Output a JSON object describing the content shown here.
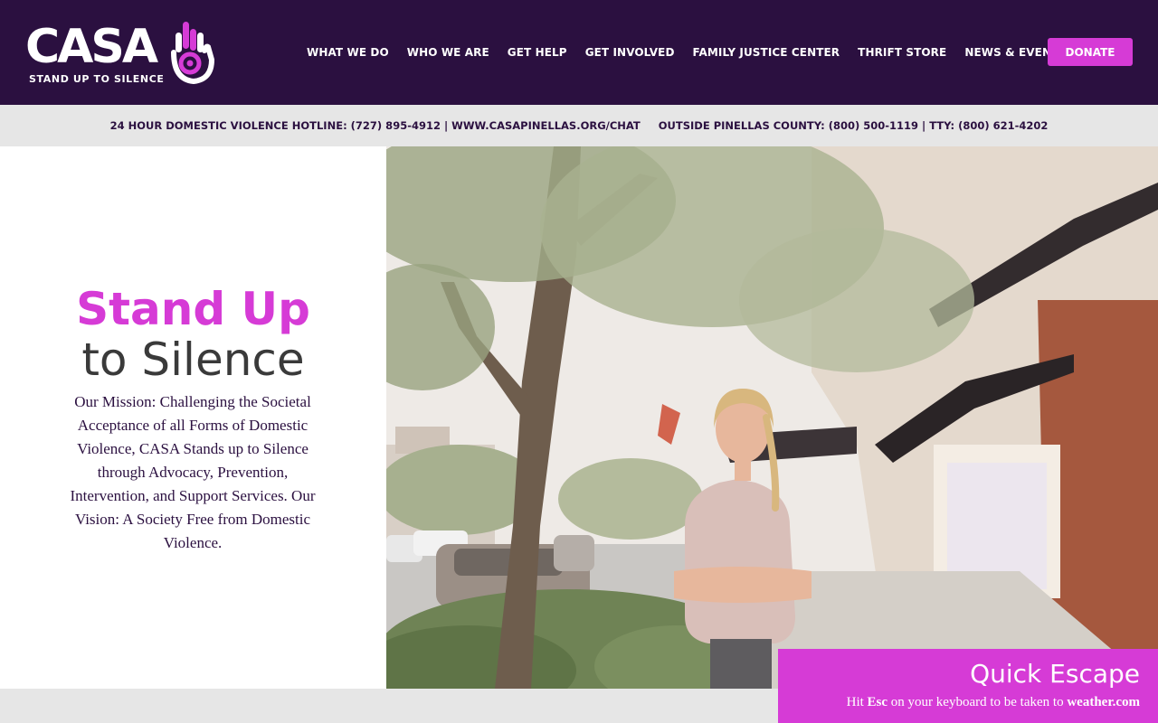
{
  "logo": {
    "word": "CASA",
    "tagline": "STAND UP TO SILENCE"
  },
  "nav": {
    "items": [
      {
        "label": "WHAT WE DO"
      },
      {
        "label": "WHO WE ARE"
      },
      {
        "label": "GET HELP"
      },
      {
        "label": "GET INVOLVED"
      },
      {
        "label": "FAMILY JUSTICE CENTER"
      },
      {
        "label": "THRIFT STORE"
      },
      {
        "label": "NEWS & EVENTS"
      }
    ],
    "donate_label": "DONATE"
  },
  "hotline": {
    "local": "24 HOUR DOMESTIC VIOLENCE HOTLINE: (727) 895-4912 | WWW.CASAPINELLAS.ORG/CHAT",
    "outside": "OUTSIDE PINELLAS COUNTY: (800) 500-1119 | TTY: (800) 621-4202"
  },
  "hero": {
    "title_line1": "Stand Up",
    "title_line2": "to Silence",
    "mission": "Our Mission: Challenging the Societal Acceptance of all Forms of Domestic Violence, CASA Stands up to Silence through Advocacy, Prevention, Intervention, and Support Services. Our Vision: A Society Free from Domestic Violence.",
    "photo_icon": "woman-standing-street-photo"
  },
  "escape": {
    "title": "Quick Escape",
    "note_prefix": "Hit",
    "note_key": "Esc",
    "note_middle": "on your keyboard to be taken to",
    "note_site": "weather.com"
  },
  "colors": {
    "header_bg": "#2b1040",
    "accent": "#d63bd6",
    "hotline_bg": "#e6e6e6",
    "title_dark": "#3a3a3a"
  }
}
